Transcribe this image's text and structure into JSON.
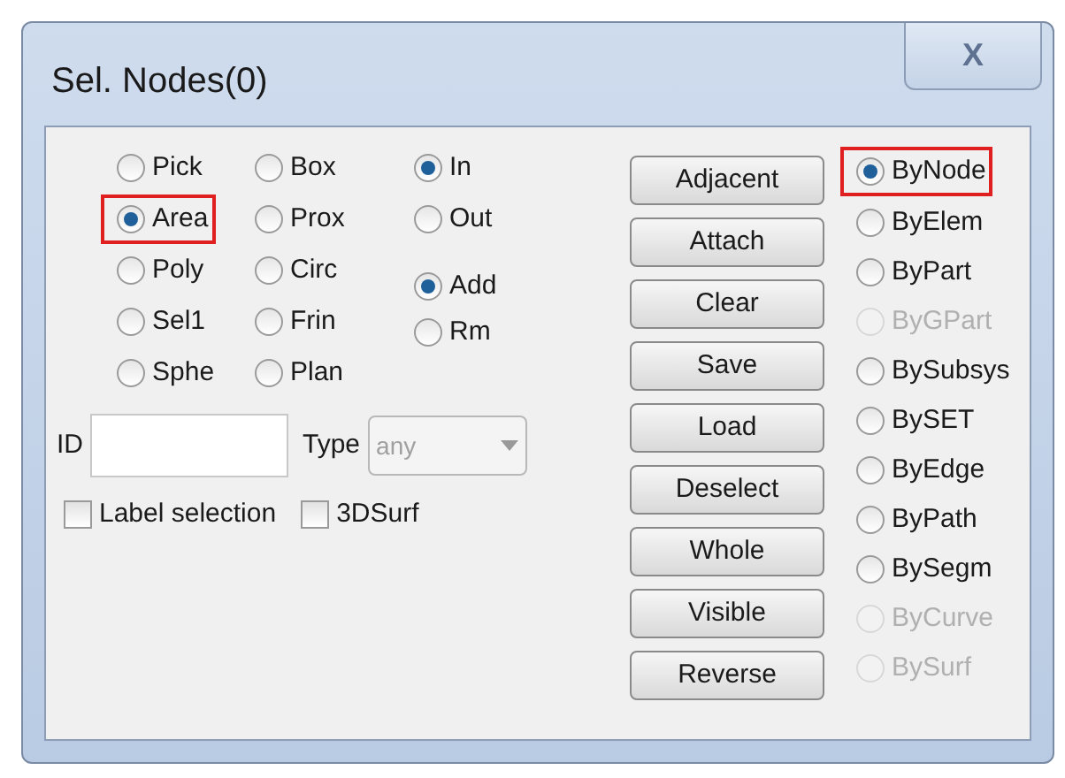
{
  "window": {
    "title": "Sel. Nodes(0)",
    "close": "X"
  },
  "shape_options": [
    {
      "label": "Pick",
      "selected": false,
      "highlighted": false
    },
    {
      "label": "Box",
      "selected": false,
      "highlighted": false
    },
    {
      "label": "Area",
      "selected": true,
      "highlighted": true
    },
    {
      "label": "Prox",
      "selected": false,
      "highlighted": false
    },
    {
      "label": "Poly",
      "selected": false,
      "highlighted": false
    },
    {
      "label": "Circ",
      "selected": false,
      "highlighted": false
    },
    {
      "label": "Sel1",
      "selected": false,
      "highlighted": false
    },
    {
      "label": "Frin",
      "selected": false,
      "highlighted": false
    },
    {
      "label": "Sphe",
      "selected": false,
      "highlighted": false
    },
    {
      "label": "Plan",
      "selected": false,
      "highlighted": false
    }
  ],
  "scope_options": [
    {
      "label": "In",
      "selected": true
    },
    {
      "label": "Out",
      "selected": false
    }
  ],
  "mode_options": [
    {
      "label": "Add",
      "selected": true
    },
    {
      "label": "Rm",
      "selected": false
    }
  ],
  "id_field": {
    "label": "ID"
  },
  "type_field": {
    "label": "Type",
    "value": "any"
  },
  "checkboxes": [
    {
      "label": "Label selection",
      "checked": false
    },
    {
      "label": "3DSurf",
      "checked": false
    }
  ],
  "buttons": [
    "Adjacent",
    "Attach",
    "Clear",
    "Save",
    "Load",
    "Deselect",
    "Whole",
    "Visible",
    "Reverse"
  ],
  "by_options": [
    {
      "label": "ByNode",
      "selected": true,
      "disabled": false,
      "highlighted": true
    },
    {
      "label": "ByElem",
      "selected": false,
      "disabled": false,
      "highlighted": false
    },
    {
      "label": "ByPart",
      "selected": false,
      "disabled": false,
      "highlighted": false
    },
    {
      "label": "ByGPart",
      "selected": false,
      "disabled": true,
      "highlighted": false
    },
    {
      "label": "BySubsys",
      "selected": false,
      "disabled": false,
      "highlighted": false
    },
    {
      "label": "BySET",
      "selected": false,
      "disabled": false,
      "highlighted": false
    },
    {
      "label": "ByEdge",
      "selected": false,
      "disabled": false,
      "highlighted": false
    },
    {
      "label": "ByPath",
      "selected": false,
      "disabled": false,
      "highlighted": false
    },
    {
      "label": "BySegm",
      "selected": false,
      "disabled": false,
      "highlighted": false
    },
    {
      "label": "ByCurve",
      "selected": false,
      "disabled": true,
      "highlighted": false
    },
    {
      "label": "BySurf",
      "selected": false,
      "disabled": true,
      "highlighted": false
    }
  ]
}
